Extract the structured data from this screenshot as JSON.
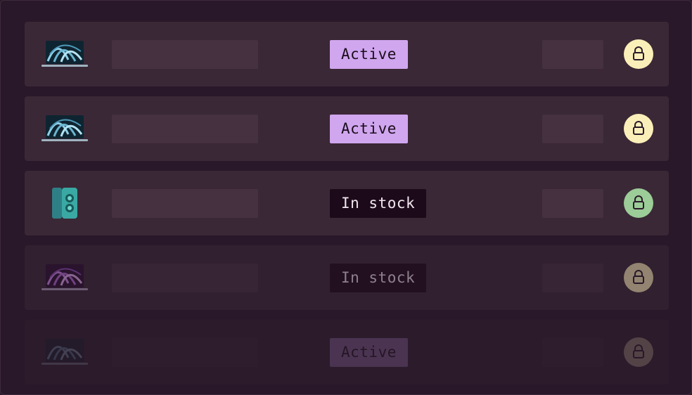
{
  "rows": [
    {
      "product": "laptop-blue",
      "status": "Active",
      "status_kind": "active",
      "lock_color": "yellow",
      "lock_icon": "lock-icon"
    },
    {
      "product": "laptop-blue",
      "status": "Active",
      "status_kind": "active",
      "lock_color": "yellow",
      "lock_icon": "lock-icon"
    },
    {
      "product": "phone-teal",
      "status": "In stock",
      "status_kind": "stock",
      "lock_color": "green",
      "lock_icon": "lock-icon"
    },
    {
      "product": "laptop-purple",
      "status": "In stock",
      "status_kind": "stock",
      "lock_color": "yellow",
      "lock_icon": "lock-icon"
    },
    {
      "product": "laptop-blue",
      "status": "Active",
      "status_kind": "active",
      "lock_color": "yellow",
      "lock_icon": "lock-icon"
    }
  ],
  "colors": {
    "active_badge": "#d0a6ef",
    "stock_badge": "#1c0a1a",
    "lock_yellow": "#fbefb9",
    "lock_green": "#9ccc98"
  }
}
